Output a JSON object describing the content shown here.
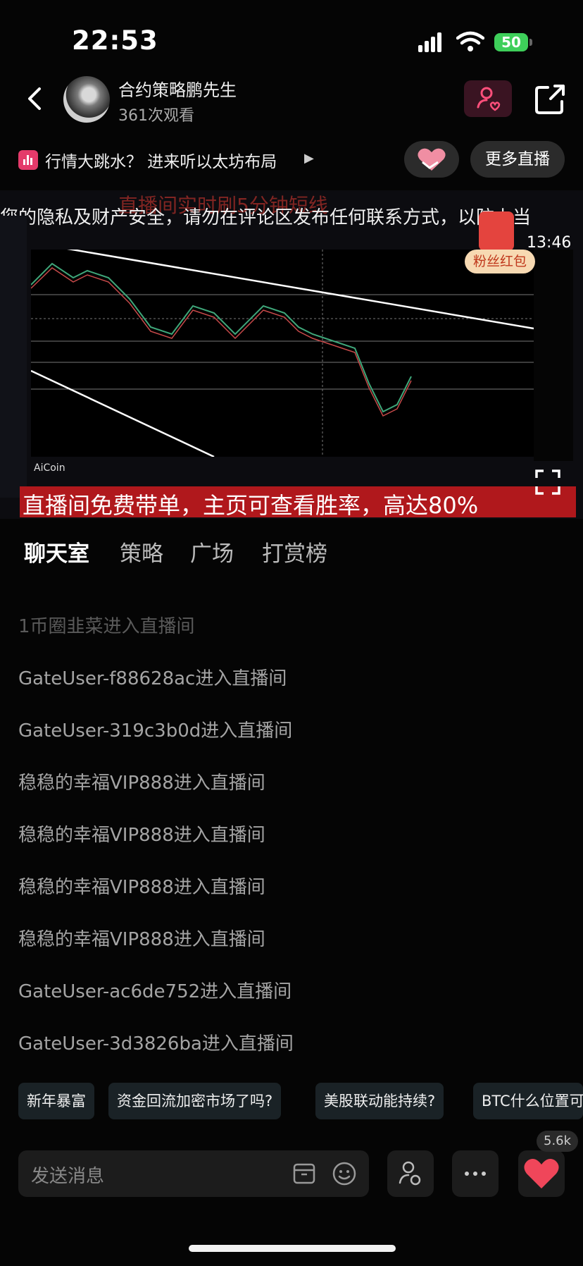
{
  "status_bar": {
    "time": "22:53",
    "battery": "50"
  },
  "header": {
    "host_name": "合约策略鹏先生",
    "views": "361次观看"
  },
  "topic": {
    "text": "行情大跳水？ 进来听以太坊布局",
    "more_live": "更多直播"
  },
  "video": {
    "notice": "您的隐私及财产安全，请勿在评论区发布任何联系方式，以防上当",
    "ghost_title": "直播间实时刷5分钟短线",
    "bottom_banner": "直播间免费带单，主页可查看胜率，高达80%",
    "redpack_label": "粉丝红包",
    "countdown": "13:46",
    "aicoin": "AiCoin"
  },
  "tabs": [
    "聊天室",
    "策略",
    "广场",
    "打赏榜"
  ],
  "chat": [
    "1币圈韭菜进入直播间",
    "GateUser-f88628ac进入直播间",
    "GateUser-319c3b0d进入直播间",
    "稳稳的幸福VIP888进入直播间",
    "稳稳的幸福VIP888进入直播间",
    "稳稳的幸福VIP888进入直播间",
    "稳稳的幸福VIP888进入直播间",
    "GateUser-ac6de752进入直播间",
    "GateUser-3d3826ba进入直播间"
  ],
  "quick_replies": [
    "新年暴富",
    "资金回流加密市场了吗?",
    "美股联动能持续?",
    "BTC什么位置可"
  ],
  "bottom": {
    "placeholder": "发送消息",
    "like_count": "5.6k"
  },
  "colors": {
    "accent": "#e43a6a",
    "banner_red": "#b0181c",
    "like_red": "#f0465a"
  }
}
